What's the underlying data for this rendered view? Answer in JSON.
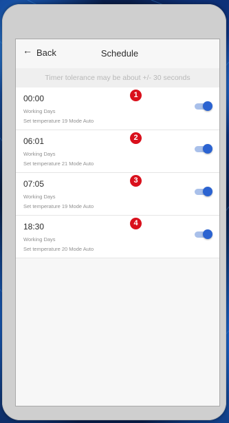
{
  "header": {
    "back_label": "Back",
    "back_arrow": "←",
    "title": "Schedule"
  },
  "notice": "Timer tolerance may be about +/- 30 seconds",
  "schedules": [
    {
      "time": "00:00",
      "days": "Working Days",
      "detail": "Set temperature 19 Mode Auto",
      "badge": "1",
      "enabled": true
    },
    {
      "time": "06:01",
      "days": "Working Days",
      "detail": "Set temperature 21 Mode Auto",
      "badge": "2",
      "enabled": true
    },
    {
      "time": "07:05",
      "days": "Working Days",
      "detail": "Set temperature 19 Mode Auto",
      "badge": "3",
      "enabled": true
    },
    {
      "time": "18:30",
      "days": "Working Days",
      "detail": "Set temperature 20 Mode Auto",
      "badge": "4",
      "enabled": true
    }
  ],
  "colors": {
    "badge": "#d9101c",
    "toggle_on": "#2b63d1",
    "toggle_track": "#a9c0ea"
  }
}
